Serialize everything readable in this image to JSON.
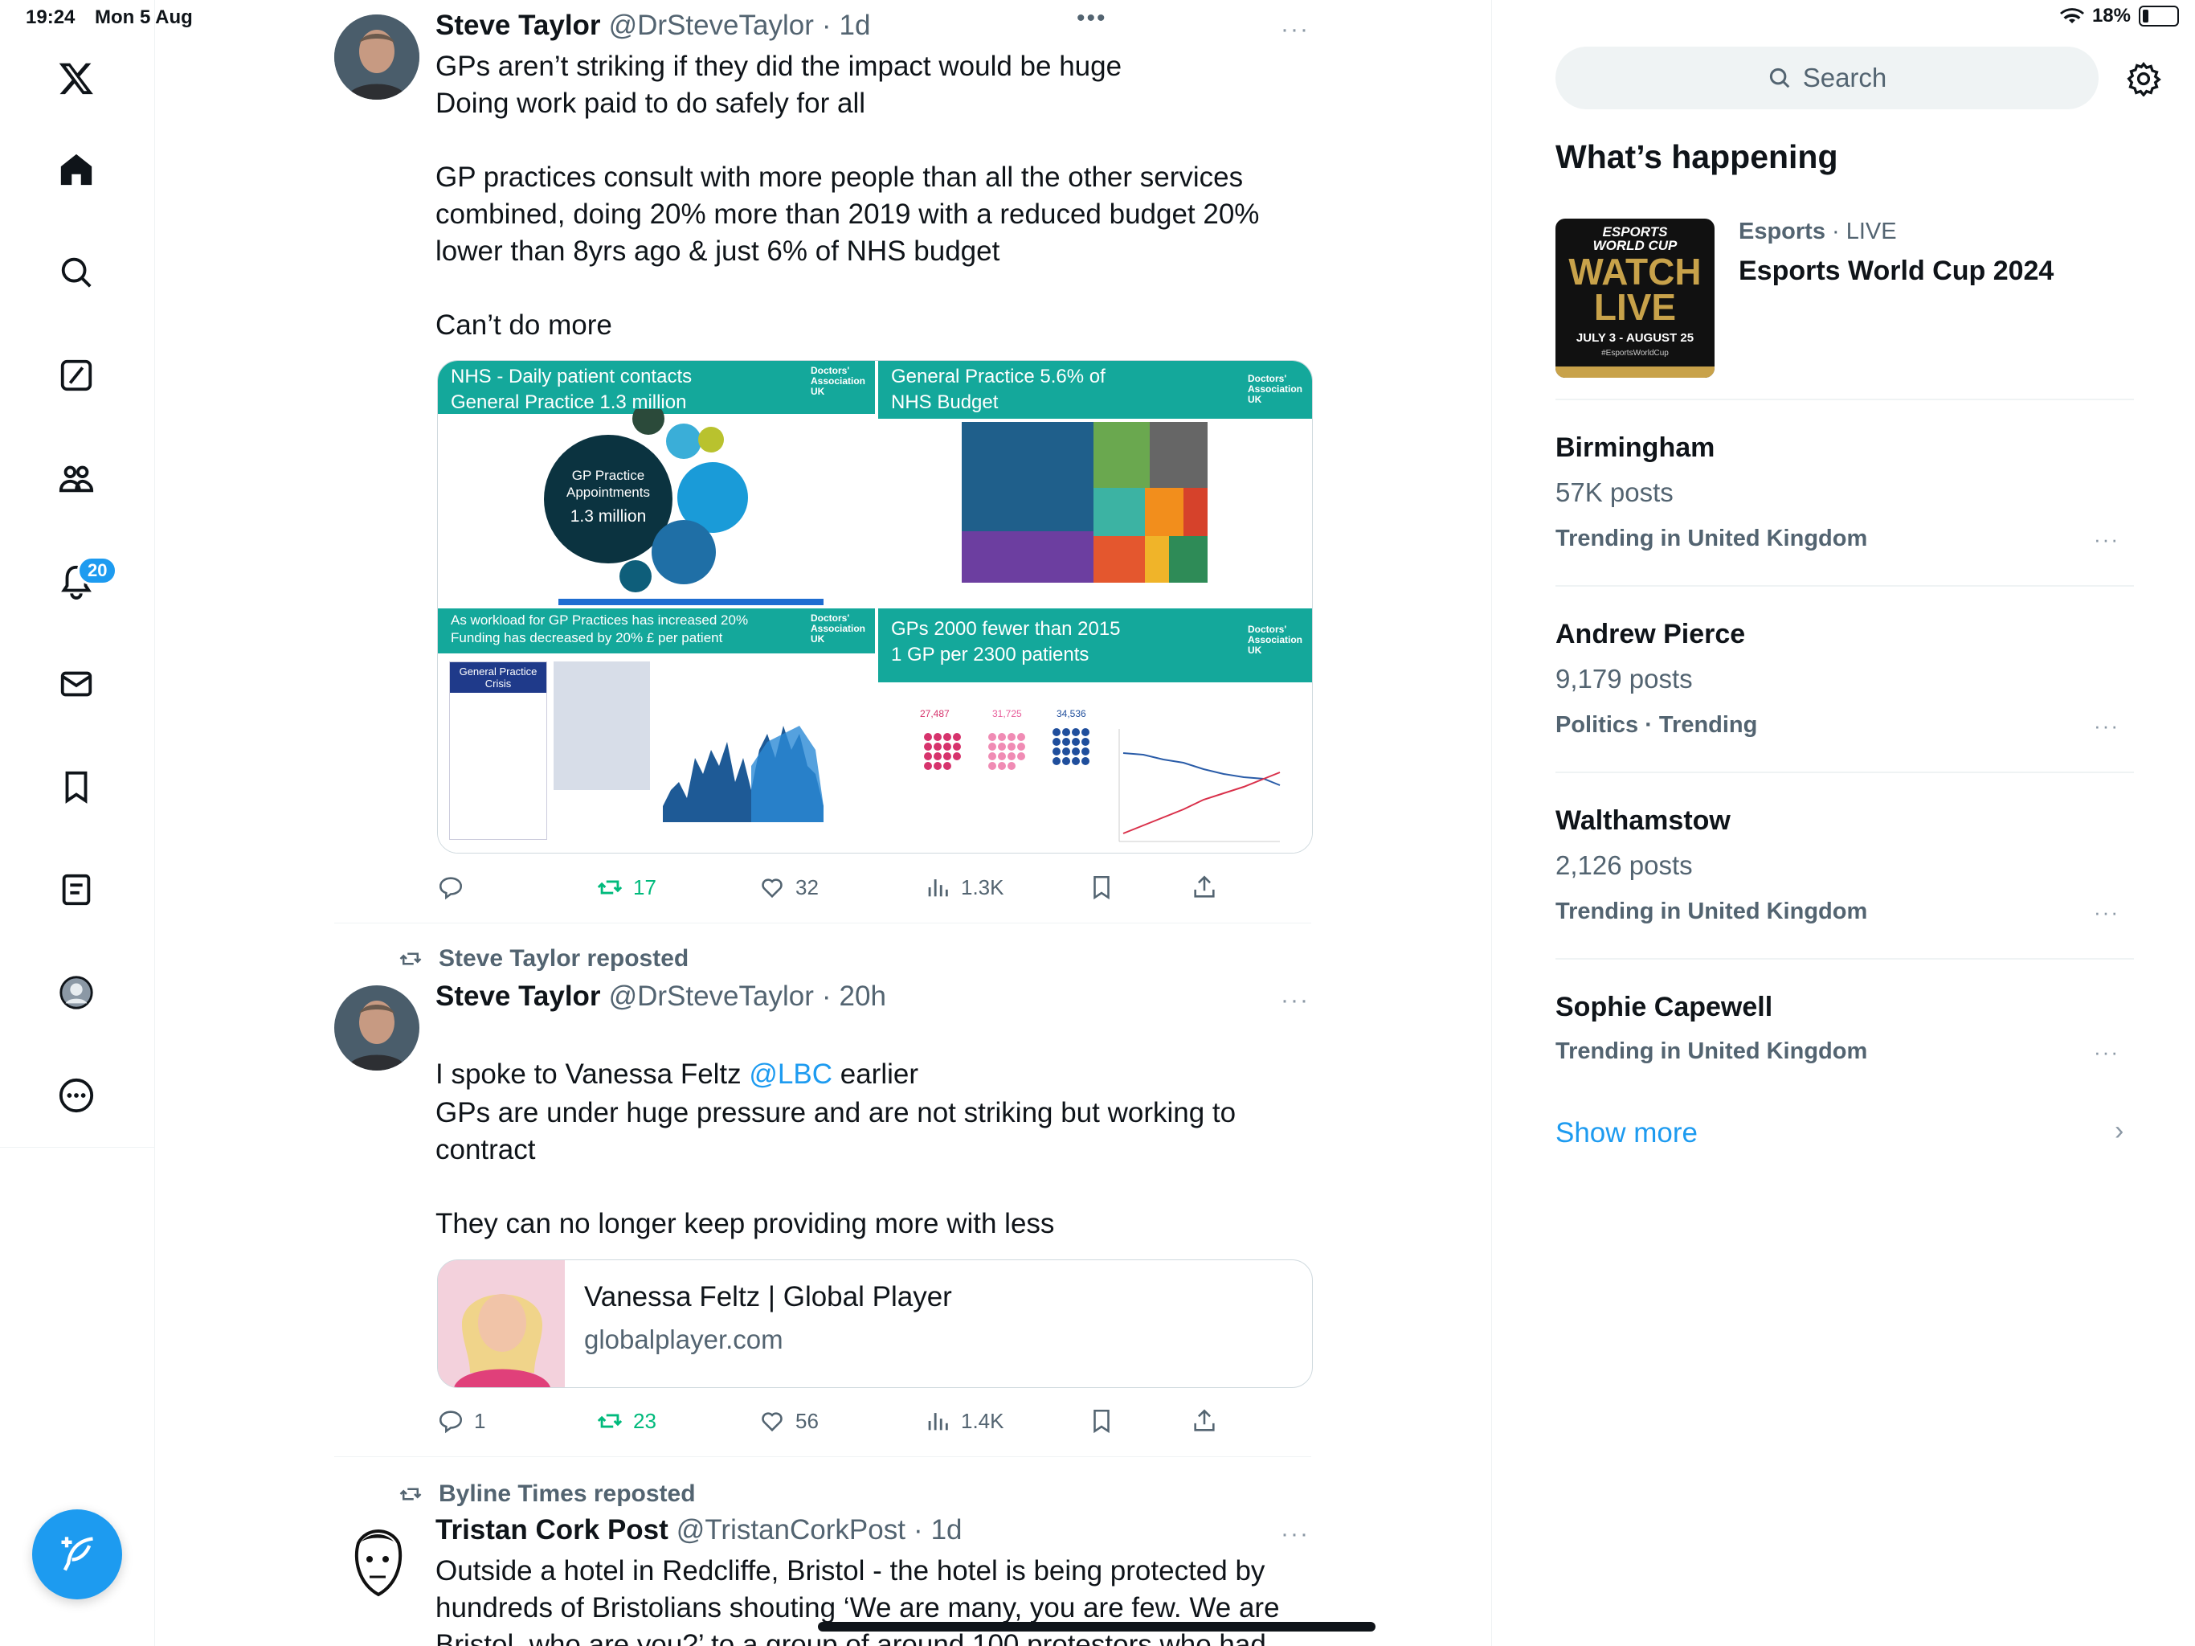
{
  "status_bar": {
    "time": "19:24",
    "date": "Mon 5 Aug",
    "battery": "18%"
  },
  "nav": {
    "items": [
      "X logo",
      "Home",
      "Explore",
      "Grok",
      "Communities",
      "Notifications",
      "Messages",
      "Bookmarks",
      "Lists",
      "Profile",
      "More"
    ],
    "notification_count": "20"
  },
  "tweets": [
    {
      "name": "Steve Taylor",
      "handle": "@DrSteveTaylor",
      "sep": "·",
      "time": "1d",
      "text": "GPs aren’t striking if they did the impact would be huge\nDoing work paid to do safely for all\n\nGP practices consult with more people than all the other services combined, doing 20% more than 2019 with a reduced budget 20% lower than 8yrs ago & just 6% of NHS budget\n\nCan’t do more",
      "media": [
        {
          "header": "NHS - Daily patient contacts\nGeneral Practice 1.3 million",
          "logo": "Doctors'\nAssociation\nUK",
          "main_bubble": "GP Practice\nAppointments",
          "main_value": "1.3 million"
        },
        {
          "header": "General Practice 5.6% of\nNHS Budget",
          "logo": "Doctors'\nAssociation\nUK"
        },
        {
          "header": "As workload for GP Practices has increased 20%\nFunding has decreased by 20% £ per patient",
          "logo": "Doctors'\nAssociation\nUK",
          "sub_label": "General Practice\nCrisis"
        },
        {
          "header": "GPs 2000 fewer than 2015\n1 GP per 2300 patients",
          "logo": "Doctors'\nAssociation\nUK",
          "stats": [
            "27,487",
            "31,725",
            "34,536"
          ]
        }
      ],
      "replies": "",
      "reposts": "17",
      "likes": "32",
      "views": "1.3K"
    },
    {
      "repost_by": "Steve Taylor reposted",
      "name": "Steve Taylor",
      "handle": "@DrSteveTaylor",
      "sep": "·",
      "time": "20h",
      "text_before": "I spoke to Vanessa Feltz ",
      "mention": "@LBC",
      "text_after": " earlier",
      "text_body": "GPs are under huge pressure and are not striking but working to contract\n\nThey can no longer keep providing more with less",
      "card_title": "Vanessa Feltz | Global Player",
      "card_domain": "globalplayer.com",
      "replies": "1",
      "reposts": "23",
      "likes": "56",
      "views": "1.4K"
    },
    {
      "repost_by": "Byline Times reposted",
      "name": "Tristan Cork Post",
      "handle": "@TristanCorkPost",
      "sep": "·",
      "time": "1d",
      "text": "Outside a hotel in Redcliffe, Bristol - the hotel is being protected by hundreds of Bristolians shouting ‘We are many, you are few. We are Bristol, who are you?’ to a group of around 100 protestors who had"
    }
  ],
  "sidebar": {
    "search_placeholder": "Search",
    "whats_happening": "What’s happening",
    "event": {
      "category": "Esports",
      "live": "· LIVE",
      "title": "Esports World Cup 2024",
      "thumb_top": "ESPORTS\nWORLD CUP",
      "thumb_main": "WATCH\nLIVE",
      "thumb_dates": "JULY 3 - AUGUST 25",
      "thumb_tag": "#EsportsWorldCup"
    },
    "trends": [
      {
        "title": "Birmingham",
        "posts": "57K posts",
        "context": "Trending in United Kingdom"
      },
      {
        "title": "Andrew Pierce",
        "posts": "9,179 posts",
        "context": "Politics · Trending"
      },
      {
        "title": "Walthamstow",
        "posts": "2,126 posts",
        "context": "Trending in United Kingdom"
      },
      {
        "title": "Sophie Capewell",
        "posts": "",
        "context": "Trending in United Kingdom"
      }
    ],
    "show_more": "Show more",
    "more_glyph": "···",
    "chevron": "›"
  }
}
